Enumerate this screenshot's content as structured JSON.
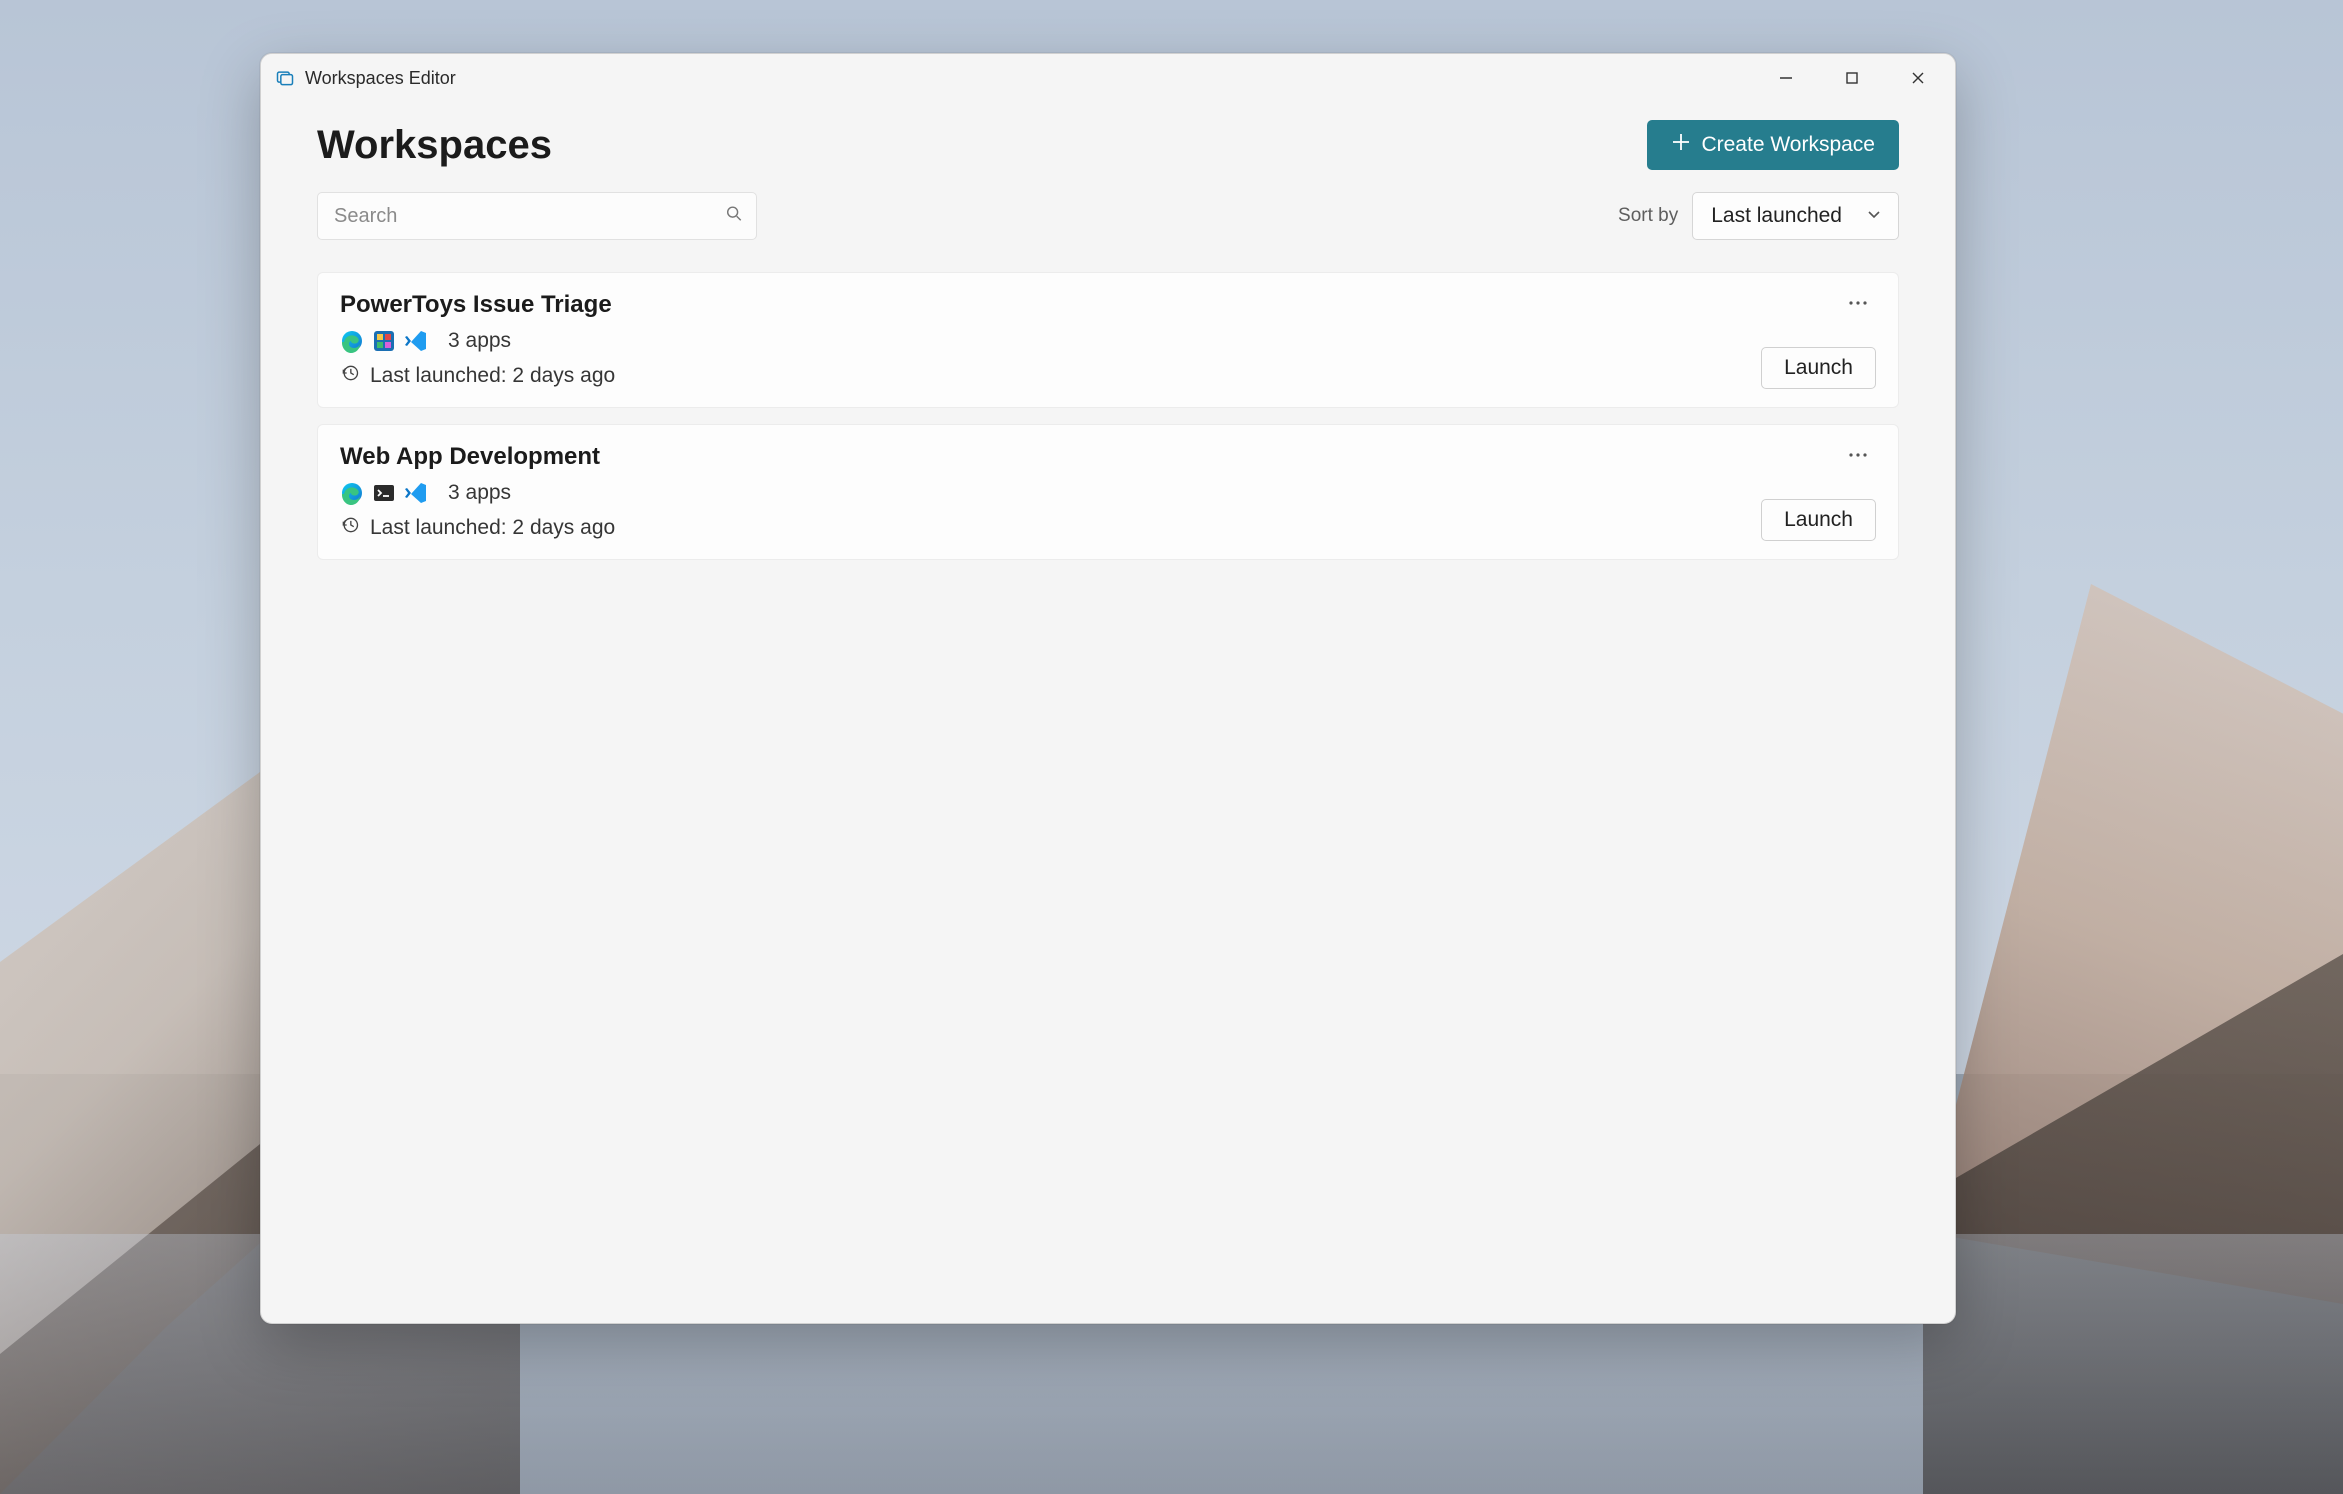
{
  "window": {
    "title": "Workspaces Editor"
  },
  "page": {
    "title": "Workspaces"
  },
  "create_button": {
    "label": "Create Workspace"
  },
  "search": {
    "placeholder": "Search"
  },
  "sort": {
    "label": "Sort by",
    "selected": "Last launched"
  },
  "workspaces": [
    {
      "title": "PowerToys Issue Triage",
      "apps_count": "3 apps",
      "last_launched": "Last launched: 2 days ago",
      "launch_label": "Launch",
      "apps": [
        "edge",
        "powertoys",
        "vscode"
      ]
    },
    {
      "title": "Web App Development",
      "apps_count": "3 apps",
      "last_launched": "Last launched: 2 days ago",
      "launch_label": "Launch",
      "apps": [
        "edge",
        "terminal",
        "vscode"
      ]
    }
  ]
}
